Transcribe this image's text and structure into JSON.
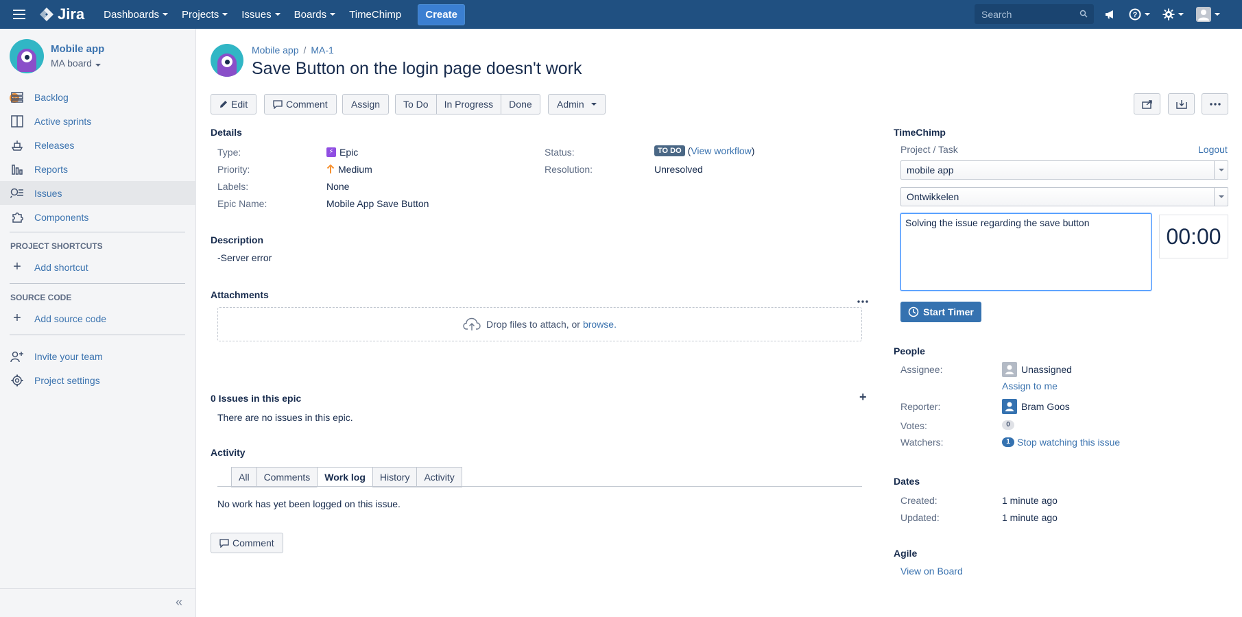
{
  "topbar": {
    "logo_text": "Jira",
    "nav": [
      "Dashboards",
      "Projects",
      "Issues",
      "Boards"
    ],
    "timechimp": "TimeChimp",
    "create": "Create",
    "search_placeholder": "Search"
  },
  "sidebar": {
    "project_name": "Mobile app",
    "board_name": "MA board",
    "items": {
      "backlog": "Backlog",
      "active_sprints": "Active sprints",
      "releases": "Releases",
      "reports": "Reports",
      "issues": "Issues",
      "components": "Components"
    },
    "project_shortcuts_heading": "PROJECT SHORTCUTS",
    "add_shortcut": "Add shortcut",
    "source_code_heading": "SOURCE CODE",
    "add_source_code": "Add source code",
    "invite_team": "Invite your team",
    "project_settings": "Project settings"
  },
  "issue": {
    "breadcrumb_project": "Mobile app",
    "breadcrumb_key": "MA-1",
    "title": "Save Button on the login page doesn't work"
  },
  "toolbar": {
    "edit": "Edit",
    "comment": "Comment",
    "assign": "Assign",
    "todo": "To Do",
    "in_progress": "In Progress",
    "done": "Done",
    "admin": "Admin"
  },
  "details": {
    "heading": "Details",
    "type_label": "Type:",
    "type_value": "Epic",
    "priority_label": "Priority:",
    "priority_value": "Medium",
    "labels_label": "Labels:",
    "labels_value": "None",
    "epic_name_label": "Epic Name:",
    "epic_name_value": "Mobile App Save Button",
    "status_label": "Status:",
    "status_value": "TO DO",
    "view_workflow": "View workflow",
    "resolution_label": "Resolution:",
    "resolution_value": "Unresolved"
  },
  "description": {
    "heading": "Description",
    "text": "-Server error"
  },
  "attachments": {
    "heading": "Attachments",
    "drop_text": "Drop files to attach, or",
    "browse": "browse."
  },
  "epic_issues": {
    "heading": "0 Issues in this epic",
    "empty": "There are no issues in this epic."
  },
  "activity": {
    "heading": "Activity",
    "tabs": [
      "All",
      "Comments",
      "Work log",
      "History",
      "Activity"
    ],
    "active_tab": "Work log",
    "empty": "No work has yet been logged on this issue.",
    "comment_button": "Comment"
  },
  "timechimp": {
    "heading": "TimeChimp",
    "project_task_label": "Project / Task",
    "logout": "Logout",
    "project_value": "mobile app",
    "task_value": "Ontwikkelen",
    "note_value": "Solving the issue regarding the save button",
    "timer": "00:00",
    "start_timer": "Start Timer"
  },
  "people": {
    "heading": "People",
    "assignee_label": "Assignee:",
    "assignee_value": "Unassigned",
    "assign_to_me": "Assign to me",
    "reporter_label": "Reporter:",
    "reporter_value": "Bram Goos",
    "votes_label": "Votes:",
    "votes_value": "0",
    "watchers_label": "Watchers:",
    "watchers_count": "1",
    "stop_watching": "Stop watching this issue"
  },
  "dates": {
    "heading": "Dates",
    "created_label": "Created:",
    "created_value": "1 minute ago",
    "updated_label": "Updated:",
    "updated_value": "1 minute ago"
  },
  "agile": {
    "heading": "Agile",
    "view_on_board": "View on Board"
  },
  "colors": {
    "topbar": "#205081",
    "link": "#3b73af",
    "primary_button": "#3572b0",
    "epic": "#904ee2",
    "status_todo": "#4a6785"
  }
}
